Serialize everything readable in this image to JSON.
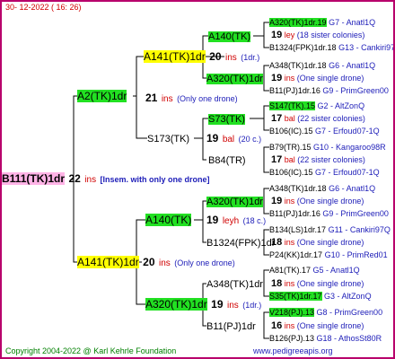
{
  "header": {
    "date": "30- 12-2022 ( 16: 26)"
  },
  "root": {
    "name": "B111(TK)1dr",
    "num": "22",
    "ins": "ins",
    "note": "[Insem. with only one drone]"
  },
  "gen1": {
    "upper": {
      "name": "A2(TK)1dr"
    },
    "lower": {
      "name": "A141(TK)1dr",
      "num": "20",
      "ins": "ins",
      "note": "(Only one drone)"
    }
  },
  "gen2": {
    "a": {
      "name": "A141(TK)1dr",
      "num": "20",
      "ins": "ins",
      "note": "(1dr.)"
    },
    "b": {
      "name": "",
      "num": "21",
      "ins": "ins",
      "note": "(Only one drone)"
    },
    "c": {
      "name": "S173(TK)",
      "num": "19",
      "ins": "bal",
      "note": "(20 c.)"
    },
    "d": {
      "name": "A140(TK)",
      "num": "19",
      "ins": "leyh",
      "note": "(18 c.)"
    },
    "e": {
      "name": "A320(TK)1dr",
      "num": "19",
      "ins": "ins",
      "note": "(1dr.)"
    }
  },
  "gen3": {
    "a1": {
      "name": "A140(TK)"
    },
    "a2": {
      "name": "A320(TK)1dr"
    },
    "c1": {
      "name": "S73(TK)",
      "num": "17",
      "ins": "bal",
      "note": "(22 sister colonies)"
    },
    "c2": {
      "name": "B84(TR)",
      "num": "17",
      "ins": "bal",
      "note": "(22 sister colonies)"
    },
    "d1": {
      "name": "A320(TK)1dr",
      "num": "19",
      "ins": "ins",
      "note": "(One single drone)"
    },
    "d2": {
      "name": "B1324(FPK)1dr",
      "num": "18",
      "ins": "ins",
      "note": "(One single drone)"
    },
    "e1": {
      "name": "A348(TK)1dr",
      "num": "18",
      "ins": "ins",
      "note": "(One single drone)"
    },
    "e2": {
      "name": "B11(PJ)1dr",
      "num": "16",
      "ins": "ins",
      "note": "(One single drone)"
    }
  },
  "gen4": [
    {
      "name": "A320(TK)1dr.19",
      "code": "G7 - Anatl1Q",
      "hl": "g"
    },
    {
      "num": "19",
      "ins": "ley",
      "note": "(18 sister colonies)"
    },
    {
      "name": "B1324(FPK)1dr.18",
      "code": "G13 - Cankiri97Q",
      "hl": ""
    },
    {
      "name": "A348(TK)1dr.18",
      "code": "G6 - Anatl1Q",
      "hl": ""
    },
    {
      "num": "19",
      "ins": "ins",
      "note": "(One single drone)"
    },
    {
      "name": "B11(PJ)1dr.16",
      "code": "G9 - PrimGreen00",
      "hl": ""
    },
    {
      "name": "S147(TK).15",
      "code": "G2 - AltZonQ",
      "hl": "g"
    },
    {
      "name": "B106(IC).15",
      "code": "G7 - Erfoud07-1Q",
      "hl": ""
    },
    {
      "name": "B79(TR).15",
      "code": "G10 - Kangaroo98R",
      "hl": ""
    },
    {
      "name": "B106(IC).15",
      "code": "G7 - Erfoud07-1Q",
      "hl": ""
    },
    {
      "name": "A348(TK)1dr.18",
      "code": "G6 - Anatl1Q",
      "hl": ""
    },
    {
      "name": "B11(PJ)1dr.16",
      "code": "G9 - PrimGreen00",
      "hl": ""
    },
    {
      "name": "B134(LS)1dr.17",
      "code": "G11 - Cankiri97Q",
      "hl": ""
    },
    {
      "name": "P24(KK)1dr.17",
      "code": "G10 - PrimRed01",
      "hl": ""
    },
    {
      "name": "A81(TK).17",
      "code": "G5 - Anatl1Q",
      "hl": ""
    },
    {
      "name": "S35(TK)1dr.17",
      "code": "G3 - AltZonQ",
      "hl": "g"
    },
    {
      "name": "V218(PJ).13",
      "code": "G8 - PrimGreen00",
      "hl": "g"
    },
    {
      "name": "B126(PJ).13",
      "code": "G18 - AthosSt80R",
      "hl": ""
    }
  ],
  "footer": {
    "copyright": "Copyright 2004-2022 @ Karl Kehrle Foundation",
    "url": "www.pedigreeapis.org"
  },
  "colors": {
    "border": "#b8006b",
    "highlight_green": "#22e022",
    "highlight_yellow": "#ffff00",
    "root_pink": "#ffb3e6",
    "ins_red": "#d00000",
    "code_blue": "#1d1db8"
  }
}
